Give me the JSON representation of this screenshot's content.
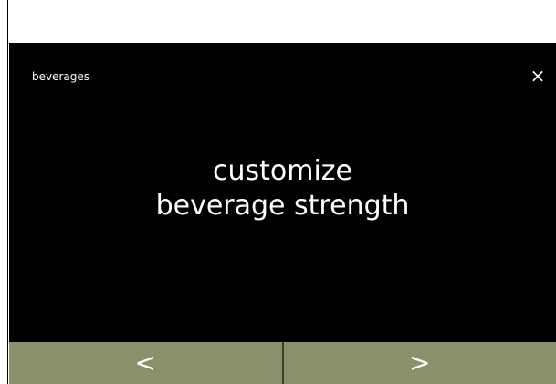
{
  "header": {
    "title": "beverages",
    "close_icon": "close-icon",
    "close_glyph": "×"
  },
  "main": {
    "line1": "customize",
    "line2": "beverage strength"
  },
  "navigation": {
    "previous_icon": "chevron-left-icon",
    "previous_glyph": "<",
    "next_icon": "chevron-right-icon",
    "next_glyph": ">"
  },
  "colors": {
    "screen_background": "#000000",
    "navigation_background": "#8b906b",
    "text": "#ffffff"
  }
}
